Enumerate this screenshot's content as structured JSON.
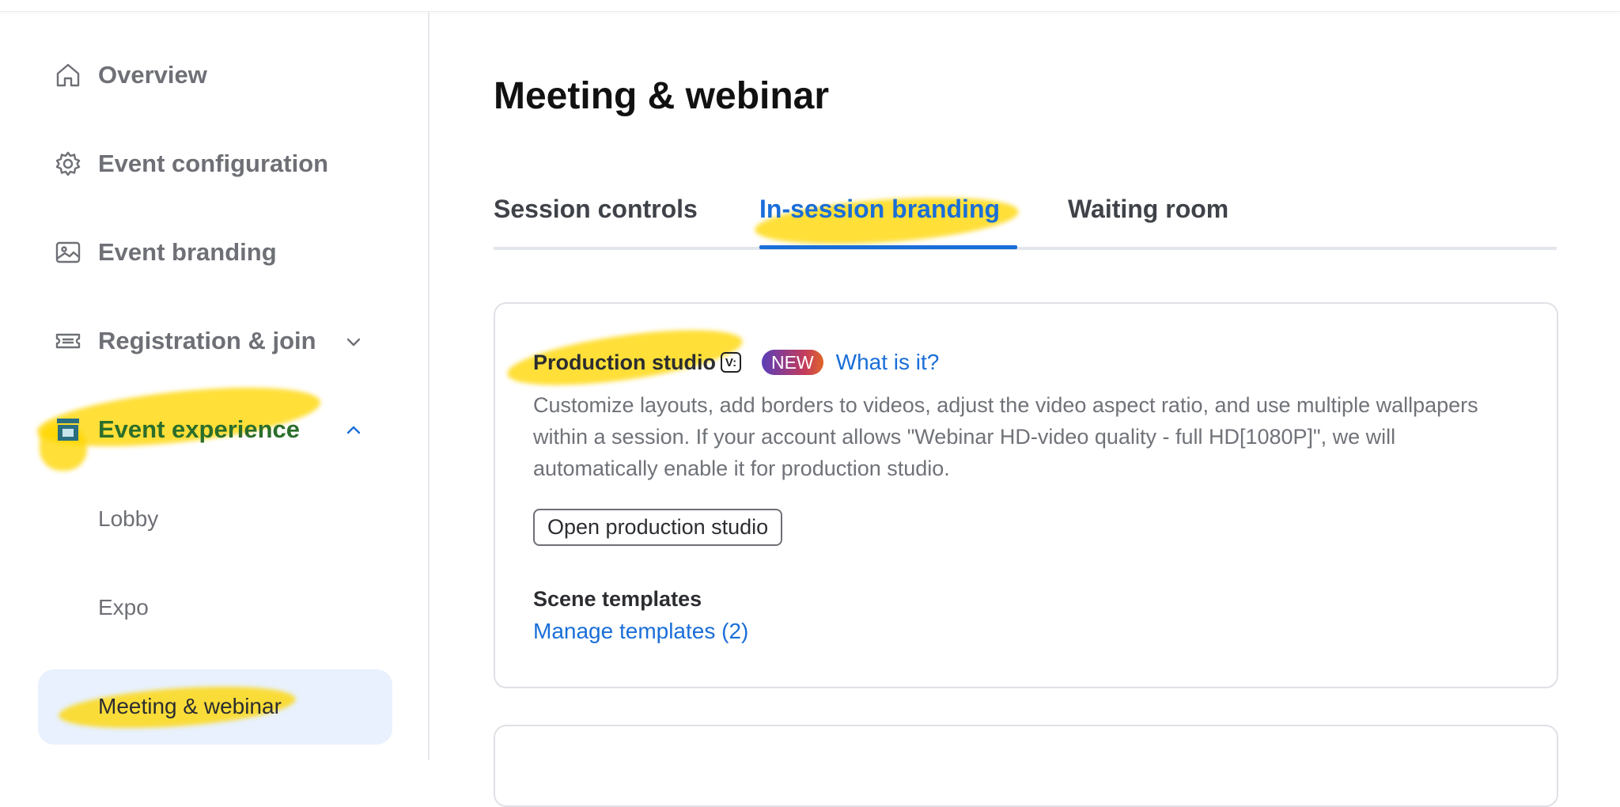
{
  "sidebar": {
    "items": [
      {
        "label": "Overview",
        "icon": "home-icon"
      },
      {
        "label": "Event configuration",
        "icon": "gear-icon"
      },
      {
        "label": "Event branding",
        "icon": "image-icon"
      },
      {
        "label": "Registration & join",
        "icon": "ticket-icon",
        "chevron": "chevron-down-icon"
      },
      {
        "label": "Event experience",
        "icon": "booth-icon",
        "chevron": "chevron-up-icon"
      }
    ],
    "subitems": [
      {
        "label": "Lobby"
      },
      {
        "label": "Expo"
      },
      {
        "label": "Meeting & webinar",
        "active": true
      }
    ]
  },
  "main": {
    "title": "Meeting & webinar",
    "tabs": [
      {
        "label": "Session controls"
      },
      {
        "label": "In-session branding",
        "active": true
      },
      {
        "label": "Waiting room"
      }
    ],
    "production_studio": {
      "title": "Production studio",
      "badge": "NEW",
      "link": "What is it?",
      "description": "Customize layouts, add borders to videos, adjust the video aspect ratio, and use multiple wallpapers within a session. If your account allows \"Webinar HD-video quality - full HD[1080P]\", we will automatically enable it for production studio.",
      "button": "Open production studio",
      "scene_templates_title": "Scene templates",
      "manage_link": "Manage templates (2)"
    }
  },
  "colors": {
    "accent": "#1a6ed8",
    "active_nav_text": "#2b6e2b",
    "highlight": "#ffd600",
    "active_bg": "#e8f1fd"
  }
}
